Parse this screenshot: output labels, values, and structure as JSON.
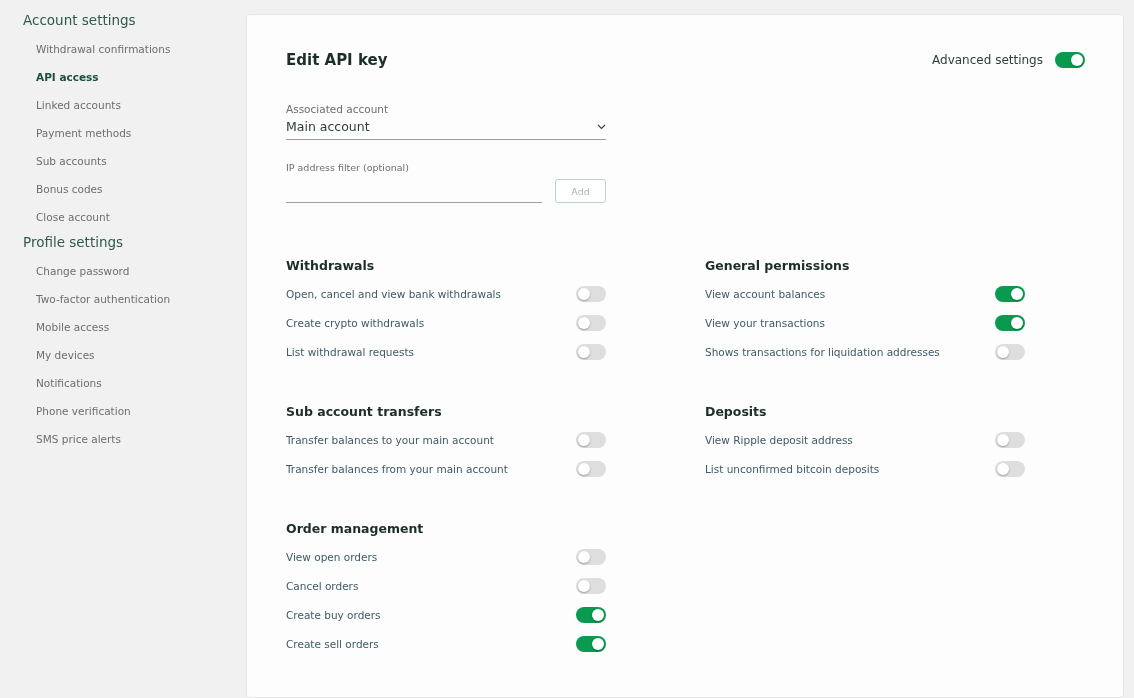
{
  "sidebar": {
    "groups": [
      {
        "title": "Account settings",
        "items": [
          {
            "label": "Withdrawal confirmations",
            "selected": false
          },
          {
            "label": "API access",
            "selected": true
          },
          {
            "label": "Linked accounts",
            "selected": false
          },
          {
            "label": "Payment methods",
            "selected": false
          },
          {
            "label": "Sub accounts",
            "selected": false
          },
          {
            "label": "Bonus codes",
            "selected": false
          },
          {
            "label": "Close account",
            "selected": false
          }
        ]
      },
      {
        "title": "Profile settings",
        "items": [
          {
            "label": "Change password",
            "selected": false
          },
          {
            "label": "Two-factor authentication",
            "selected": false
          },
          {
            "label": "Mobile access",
            "selected": false
          },
          {
            "label": "My devices",
            "selected": false
          },
          {
            "label": "Notifications",
            "selected": false
          },
          {
            "label": "Phone verification",
            "selected": false
          },
          {
            "label": "SMS price alerts",
            "selected": false
          }
        ]
      }
    ]
  },
  "page": {
    "title": "Edit API key",
    "advanced_settings": {
      "label": "Advanced settings",
      "on": true
    },
    "associated_account": {
      "label": "Associated account",
      "value": "Main account"
    },
    "ip_filter": {
      "label": "IP address filter (optional)",
      "button": "Add"
    },
    "columns": [
      [
        {
          "title": "Withdrawals",
          "permissions": [
            {
              "label": "Open, cancel and view bank withdrawals",
              "on": false
            },
            {
              "label": "Create crypto withdrawals",
              "on": false
            },
            {
              "label": "List withdrawal requests",
              "on": false
            }
          ]
        },
        {
          "title": "Sub account transfers",
          "permissions": [
            {
              "label": "Transfer balances to your main account",
              "on": false
            },
            {
              "label": "Transfer balances from your main account",
              "on": false
            }
          ]
        },
        {
          "title": "Order management",
          "permissions": [
            {
              "label": "View open orders",
              "on": false
            },
            {
              "label": "Cancel orders",
              "on": false
            },
            {
              "label": "Create buy orders",
              "on": true
            },
            {
              "label": "Create sell orders",
              "on": true
            }
          ]
        }
      ],
      [
        {
          "title": "General permissions",
          "permissions": [
            {
              "label": "View account balances",
              "on": true
            },
            {
              "label": "View your transactions",
              "on": true
            },
            {
              "label": "Shows transactions for liquidation addresses",
              "on": false
            }
          ]
        },
        {
          "title": "Deposits",
          "permissions": [
            {
              "label": "View Ripple deposit address",
              "on": false
            },
            {
              "label": "List unconfirmed bitcoin deposits",
              "on": false
            }
          ]
        }
      ]
    ]
  }
}
